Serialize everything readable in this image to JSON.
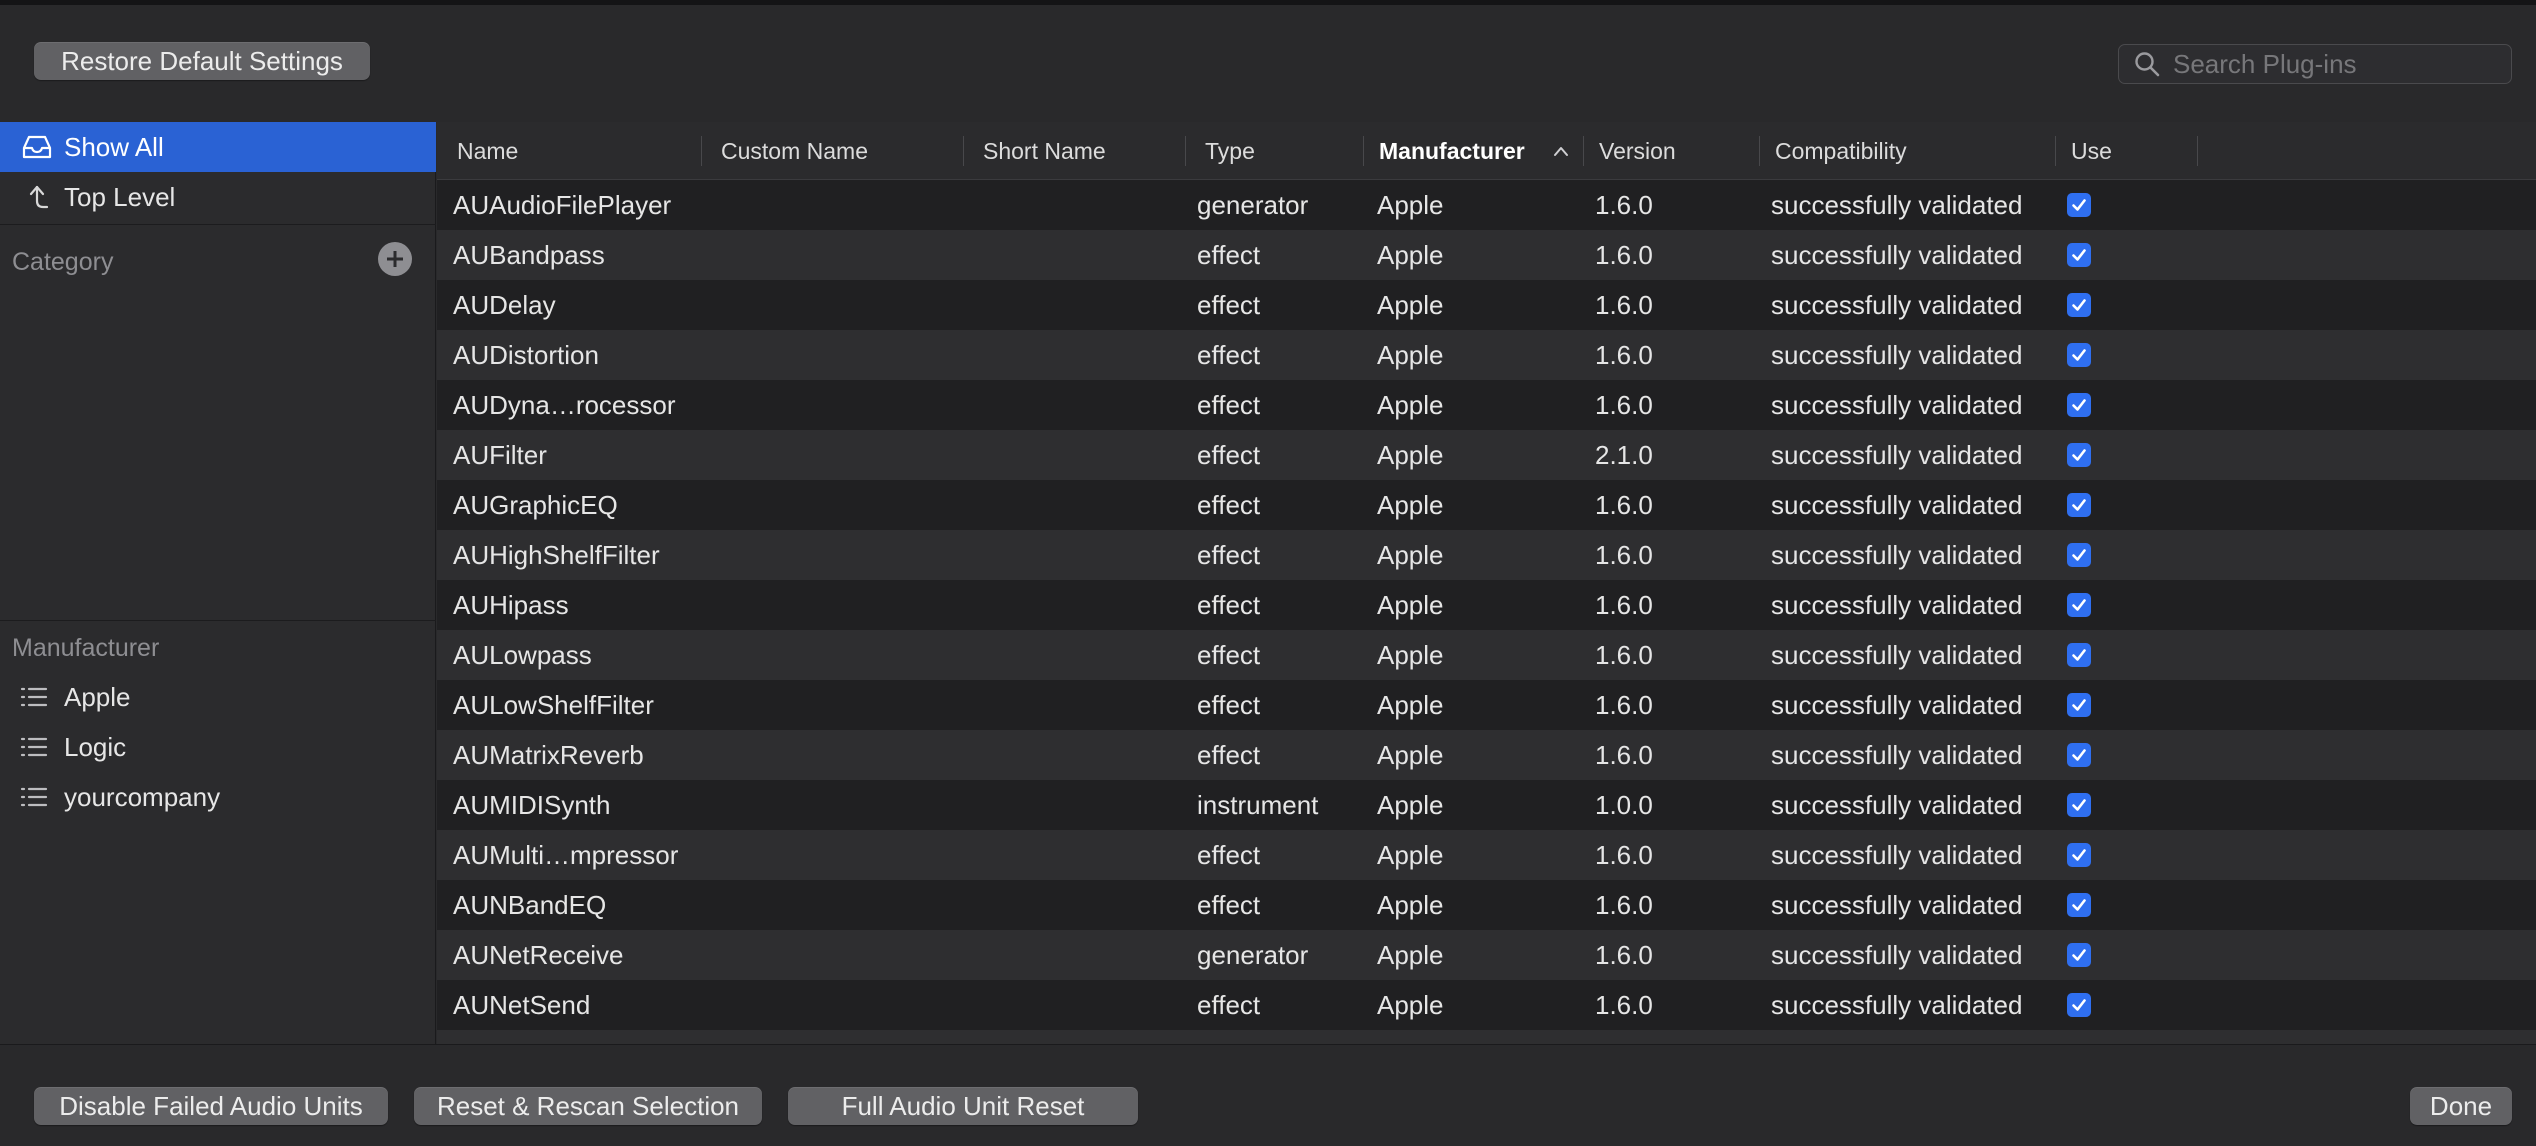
{
  "toolbar": {
    "restore_label": "Restore Default Settings"
  },
  "search": {
    "placeholder": "Search Plug-ins"
  },
  "sidebar": {
    "items": [
      {
        "label": "Show All",
        "icon": "tray-icon",
        "selected": true
      },
      {
        "label": "Top Level",
        "icon": "level-up-icon",
        "selected": false
      }
    ],
    "category_label": "Category",
    "manufacturer_label": "Manufacturer",
    "manufacturers": [
      {
        "label": "Apple",
        "icon": "list-icon"
      },
      {
        "label": "Logic",
        "icon": "list-icon"
      },
      {
        "label": "yourcompany",
        "icon": "list-icon"
      }
    ]
  },
  "table": {
    "columns": [
      "Name",
      "Custom Name",
      "Short Name",
      "Type",
      "Manufacturer",
      "Version",
      "Compatibility",
      "Use"
    ],
    "sorted_column": "Manufacturer",
    "rows": [
      {
        "name": "AUAudioFilePlayer",
        "custom": "",
        "short": "",
        "type": "generator",
        "manufacturer": "Apple",
        "version": "1.6.0",
        "compat": "successfully validated",
        "use": true
      },
      {
        "name": "AUBandpass",
        "custom": "",
        "short": "",
        "type": "effect",
        "manufacturer": "Apple",
        "version": "1.6.0",
        "compat": "successfully validated",
        "use": true
      },
      {
        "name": "AUDelay",
        "custom": "",
        "short": "",
        "type": "effect",
        "manufacturer": "Apple",
        "version": "1.6.0",
        "compat": "successfully validated",
        "use": true
      },
      {
        "name": "AUDistortion",
        "custom": "",
        "short": "",
        "type": "effect",
        "manufacturer": "Apple",
        "version": "1.6.0",
        "compat": "successfully validated",
        "use": true
      },
      {
        "name": "AUDyna…rocessor",
        "custom": "",
        "short": "",
        "type": "effect",
        "manufacturer": "Apple",
        "version": "1.6.0",
        "compat": "successfully validated",
        "use": true
      },
      {
        "name": "AUFilter",
        "custom": "",
        "short": "",
        "type": "effect",
        "manufacturer": "Apple",
        "version": "2.1.0",
        "compat": "successfully validated",
        "use": true
      },
      {
        "name": "AUGraphicEQ",
        "custom": "",
        "short": "",
        "type": "effect",
        "manufacturer": "Apple",
        "version": "1.6.0",
        "compat": "successfully validated",
        "use": true
      },
      {
        "name": "AUHighShelfFilter",
        "custom": "",
        "short": "",
        "type": "effect",
        "manufacturer": "Apple",
        "version": "1.6.0",
        "compat": "successfully validated",
        "use": true
      },
      {
        "name": "AUHipass",
        "custom": "",
        "short": "",
        "type": "effect",
        "manufacturer": "Apple",
        "version": "1.6.0",
        "compat": "successfully validated",
        "use": true
      },
      {
        "name": "AULowpass",
        "custom": "",
        "short": "",
        "type": "effect",
        "manufacturer": "Apple",
        "version": "1.6.0",
        "compat": "successfully validated",
        "use": true
      },
      {
        "name": "AULowShelfFilter",
        "custom": "",
        "short": "",
        "type": "effect",
        "manufacturer": "Apple",
        "version": "1.6.0",
        "compat": "successfully validated",
        "use": true
      },
      {
        "name": "AUMatrixReverb",
        "custom": "",
        "short": "",
        "type": "effect",
        "manufacturer": "Apple",
        "version": "1.6.0",
        "compat": "successfully validated",
        "use": true
      },
      {
        "name": "AUMIDISynth",
        "custom": "",
        "short": "",
        "type": "instrument",
        "manufacturer": "Apple",
        "version": "1.0.0",
        "compat": "successfully validated",
        "use": true
      },
      {
        "name": "AUMulti…mpressor",
        "custom": "",
        "short": "",
        "type": "effect",
        "manufacturer": "Apple",
        "version": "1.6.0",
        "compat": "successfully validated",
        "use": true
      },
      {
        "name": "AUNBandEQ",
        "custom": "",
        "short": "",
        "type": "effect",
        "manufacturer": "Apple",
        "version": "1.6.0",
        "compat": "successfully validated",
        "use": true
      },
      {
        "name": "AUNetReceive",
        "custom": "",
        "short": "",
        "type": "generator",
        "manufacturer": "Apple",
        "version": "1.6.0",
        "compat": "successfully validated",
        "use": true
      },
      {
        "name": "AUNetSend",
        "custom": "",
        "short": "",
        "type": "effect",
        "manufacturer": "Apple",
        "version": "1.6.0",
        "compat": "successfully validated",
        "use": true
      }
    ]
  },
  "footer": {
    "disable_failed_label": "Disable Failed Audio Units",
    "reset_rescan_label": "Reset & Rescan Selection",
    "full_reset_label": "Full Audio Unit Reset",
    "done_label": "Done"
  },
  "colors": {
    "accent": "#2a62d4",
    "checkbox": "#2f6ff0",
    "background": "#29292b",
    "row_alt": "#2e2e30",
    "row_base": "#202022"
  }
}
